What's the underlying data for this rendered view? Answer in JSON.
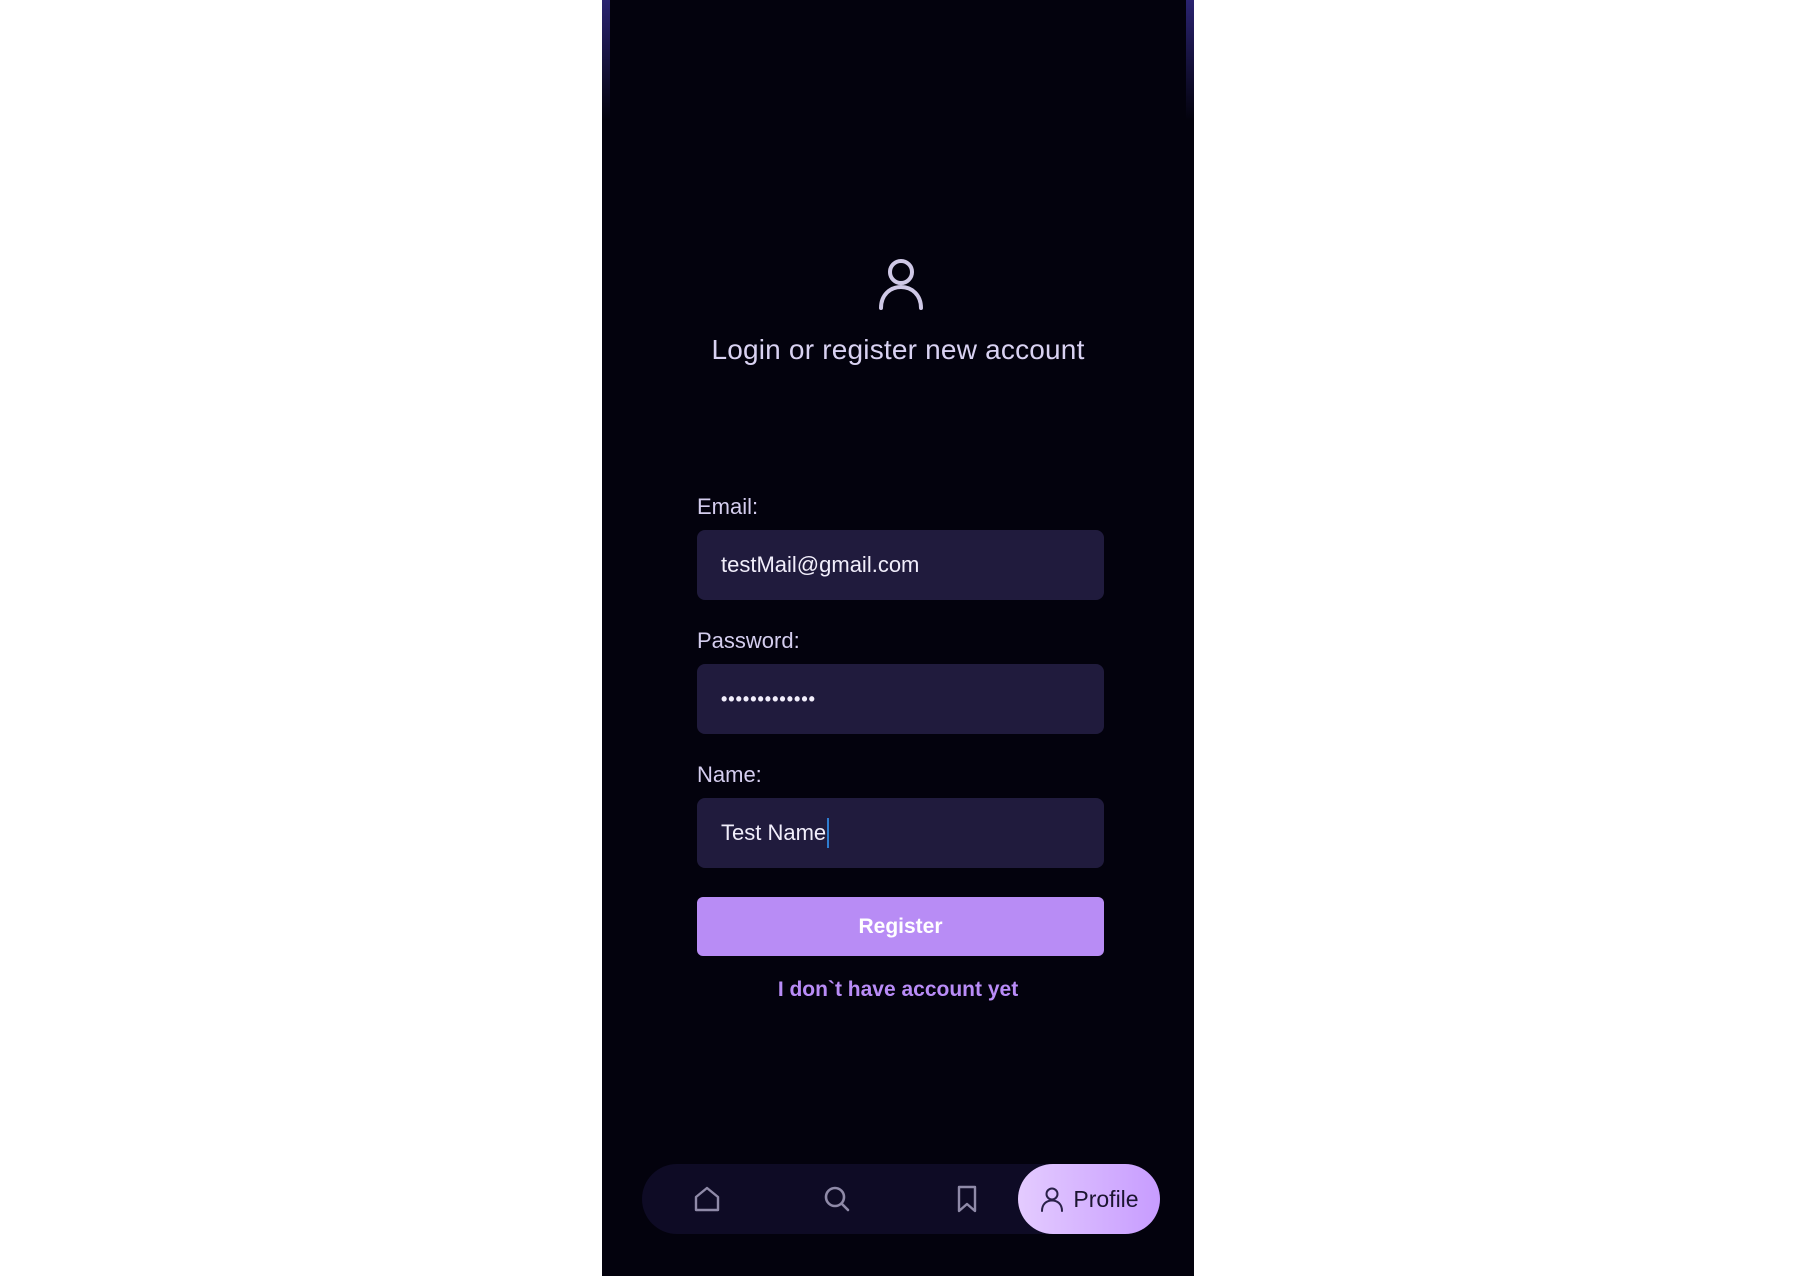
{
  "header": {
    "title": "Login or register new account"
  },
  "form": {
    "email": {
      "label": "Email:",
      "value": "testMail@gmail.com"
    },
    "password": {
      "label": "Password:",
      "value": "•••••••••••••"
    },
    "name": {
      "label": "Name:",
      "value": "Test Name"
    },
    "submit_label": "Register",
    "switch_link": "I don`t have account yet"
  },
  "bottom_nav": {
    "items": [
      {
        "icon": "home-icon"
      },
      {
        "icon": "search-icon"
      },
      {
        "icon": "bookmark-icon"
      },
      {
        "icon": "profile-icon",
        "label": "Profile",
        "active": true
      }
    ]
  },
  "colors": {
    "background": "#03020d",
    "field_background": "#201b3d",
    "accent": "#b88cf5",
    "text": "#d9d2f2"
  }
}
